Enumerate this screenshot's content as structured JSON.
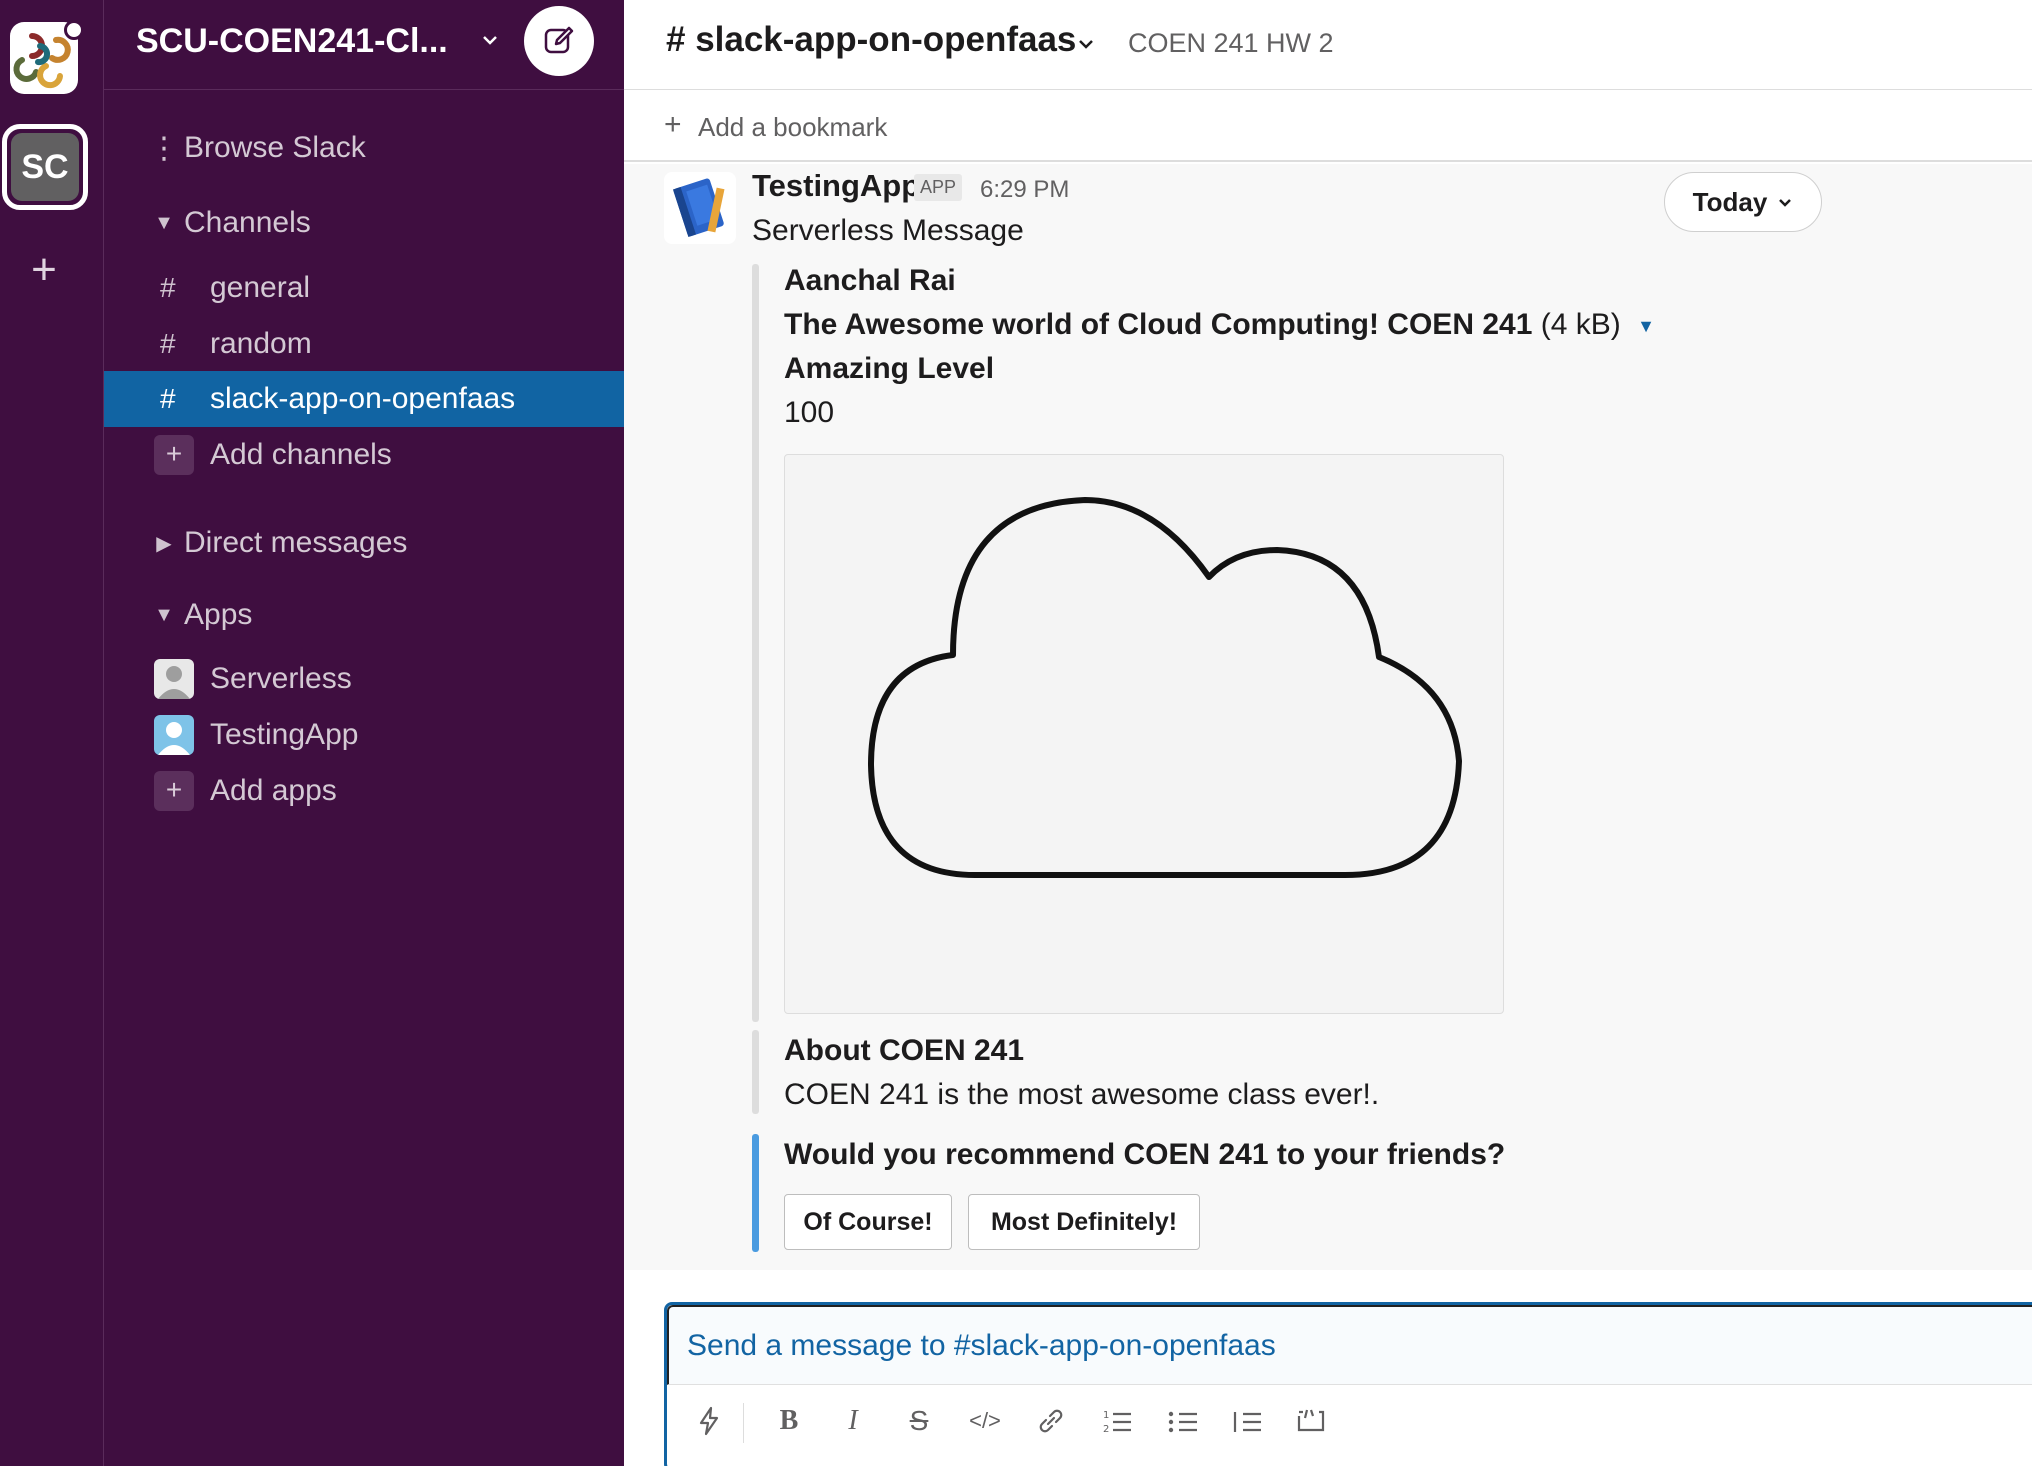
{
  "workspace_rail": {
    "initials": "SC",
    "add_icon": "plus-icon"
  },
  "sidebar": {
    "workspace_name": "SCU-COEN241-Cl...",
    "browse": "Browse Slack",
    "channels_header": "Channels",
    "channels": [
      {
        "label": "general",
        "active": false
      },
      {
        "label": "random",
        "active": false
      },
      {
        "label": "slack-app-on-openfaas",
        "active": true
      }
    ],
    "add_channels": "Add channels",
    "direct_messages_header": "Direct messages",
    "apps_header": "Apps",
    "apps": [
      {
        "label": "Serverless"
      },
      {
        "label": "TestingApp"
      }
    ],
    "add_apps": "Add apps",
    "colors": {
      "background": "#3f0e40",
      "active": "#1164a3"
    }
  },
  "channel": {
    "name": "# slack-app-on-openfaas",
    "topic": "COEN 241 HW 2",
    "add_bookmark": "Add a bookmark"
  },
  "message": {
    "sender": "TestingApp",
    "badge": "APP",
    "time": "6:29 PM",
    "text": "Serverless Message",
    "date_divider": "Today",
    "attachment1": {
      "author": "Aanchal Rai",
      "title": "The Awesome world of Cloud Computing! COEN 241",
      "size": "(4 kB)",
      "field_title": "Amazing Level",
      "field_value": "100"
    },
    "attachment2": {
      "title": "About COEN 241",
      "text": "COEN 241 is the most awesome class ever!."
    },
    "attachment3": {
      "title": "Would you recommend COEN 241 to your friends?",
      "buttons": [
        "Of Course!",
        "Most Definitely!"
      ]
    }
  },
  "composer": {
    "placeholder": "Send a message to #slack-app-on-openfaas"
  }
}
